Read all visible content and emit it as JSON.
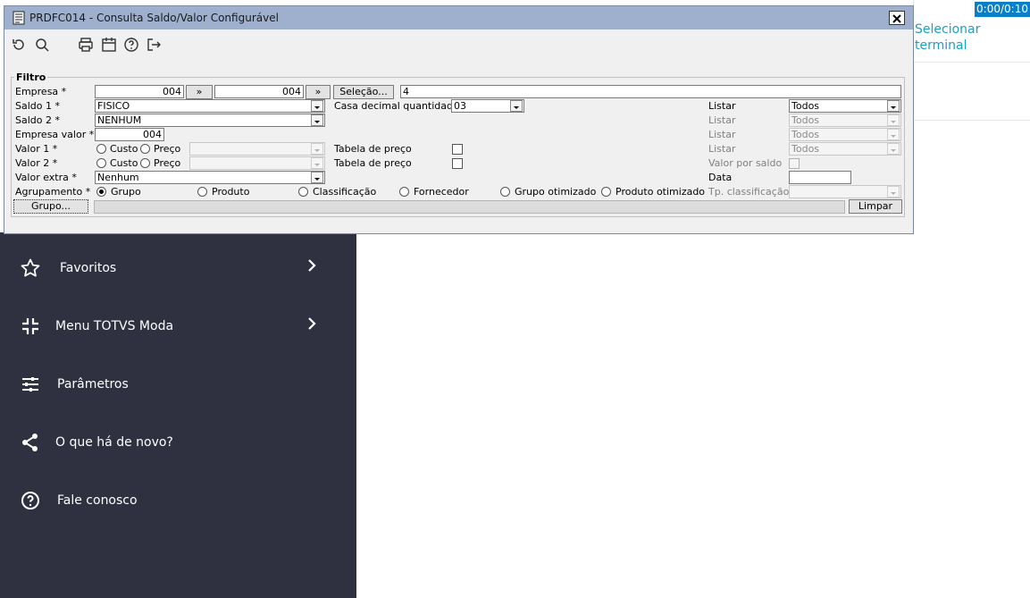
{
  "dialog": {
    "title": "PRDFC014 - Consulta Saldo/Valor Configurável",
    "toolbar": [
      "refresh-icon",
      "search-icon",
      "print-icon",
      "calendar-icon",
      "help-icon",
      "exit-icon"
    ],
    "filter": {
      "group_title": "Filtro",
      "empresa": {
        "label": "Empresa *",
        "from": "004",
        "to": "004",
        "arrow": "»",
        "selecao_label": "Seleção...",
        "selecao_value": "4"
      },
      "saldo1": {
        "label": "Saldo 1 *",
        "value": "FISICO"
      },
      "casa_decimal": {
        "label": "Casa decimal quantidade",
        "value": "03"
      },
      "saldo2": {
        "label": "Saldo 2 *",
        "value": "NENHUM"
      },
      "empresa_valor": {
        "label": "Empresa valor *",
        "value": "004"
      },
      "valor1": {
        "label": "Valor 1 *",
        "custo": "Custo",
        "preco": "Preço",
        "tabela_label": "Tabela de preço"
      },
      "valor2": {
        "label": "Valor 2 *",
        "custo": "Custo",
        "preco": "Preço",
        "tabela_label": "Tabela de preço"
      },
      "valor_extra": {
        "label": "Valor extra *",
        "value": "Nenhum"
      },
      "agrupamento": {
        "label": "Agrupamento *",
        "options": [
          "Grupo",
          "Produto",
          "Classificação",
          "Fornecedor",
          "Grupo otimizado",
          "Produto otimizado"
        ],
        "selected": "Grupo"
      },
      "listar": [
        {
          "label": "Listar",
          "value": "Todos",
          "enabled": true
        },
        {
          "label": "Listar",
          "value": "Todos",
          "enabled": false
        },
        {
          "label": "Listar",
          "value": "Todos",
          "enabled": false
        },
        {
          "label": "Listar",
          "value": "Todos",
          "enabled": false
        }
      ],
      "valor_por_saldo": {
        "label": "Valor por saldo"
      },
      "data": {
        "label": "Data"
      },
      "tp_classificacao": {
        "label": "Tp. classificação"
      },
      "grupo_button": "Grupo...",
      "limpar_button": "Limpar"
    }
  },
  "background": {
    "timer": "0:00/0:10",
    "selecionar_terminal": "Selecionar terminal",
    "sidebar": [
      {
        "label": "Favoritos",
        "icon": "star-icon",
        "chevron": true
      },
      {
        "label": "Menu TOTVS Moda",
        "icon": "collapse-icon",
        "chevron": true
      },
      {
        "label": "Parâmetros",
        "icon": "sliders-icon",
        "chevron": false
      },
      {
        "label": "O que há de novo?",
        "icon": "share-icon",
        "chevron": false
      },
      {
        "label": "Fale conosco",
        "icon": "help-circle-icon",
        "chevron": false
      }
    ]
  },
  "colors": {
    "titlebar": "#9fb0cf",
    "sidebar": "#2f3140",
    "accent": "#1ba0c4",
    "timer_bg": "#0a7fc9"
  }
}
